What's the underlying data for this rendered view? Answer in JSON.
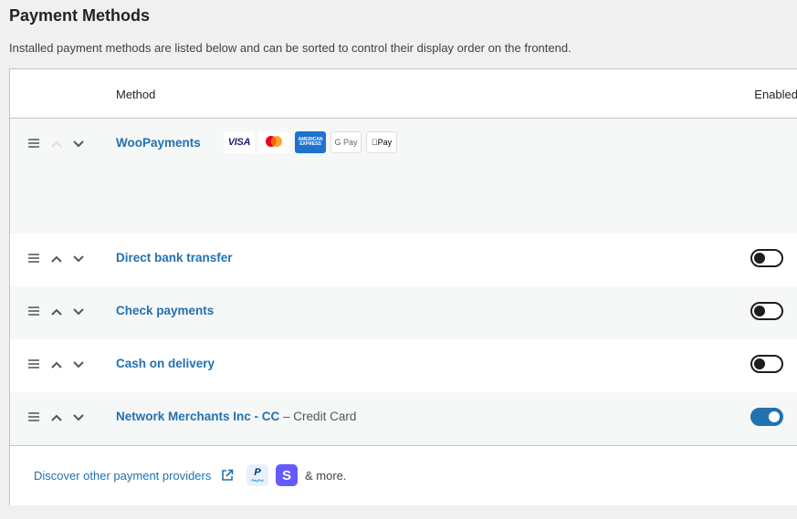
{
  "page": {
    "title": "Payment Methods",
    "description": "Installed payment methods are listed below and can be sorted to control their display order on the frontend."
  },
  "table": {
    "col_method": "Method",
    "col_enabled": "Enabled"
  },
  "methods": [
    {
      "name": "WooPayments",
      "subtitle": "",
      "enabled": null,
      "up_enabled": false,
      "card_logos": [
        {
          "name": "visa-logo",
          "text": "VISA"
        },
        {
          "name": "mastercard-logo",
          "text": "mastercard"
        },
        {
          "name": "amex-logo",
          "text": "AMERICAN EXPRESS"
        },
        {
          "name": "google-pay-logo",
          "text": "G Pay"
        },
        {
          "name": "apple-pay-logo",
          "text": "Pay"
        }
      ]
    },
    {
      "name": "Direct bank transfer",
      "subtitle": "",
      "enabled": false,
      "up_enabled": true
    },
    {
      "name": "Check payments",
      "subtitle": "",
      "enabled": false,
      "up_enabled": true
    },
    {
      "name": "Cash on delivery",
      "subtitle": "",
      "enabled": false,
      "up_enabled": true
    },
    {
      "name": "Network Merchants Inc - CC",
      "subtitle": " – Credit Card",
      "enabled": true,
      "up_enabled": true
    }
  ],
  "footer": {
    "discover_label": "Discover other payment providers",
    "paypal_logo_text": "PayPal",
    "stripe_logo_text": "S",
    "more_label": "& more."
  },
  "colors": {
    "link": "#2271b1",
    "toggle_on": "#2271b1",
    "toggle_off": "#1e1e1e",
    "background": "#f0f0f1"
  }
}
